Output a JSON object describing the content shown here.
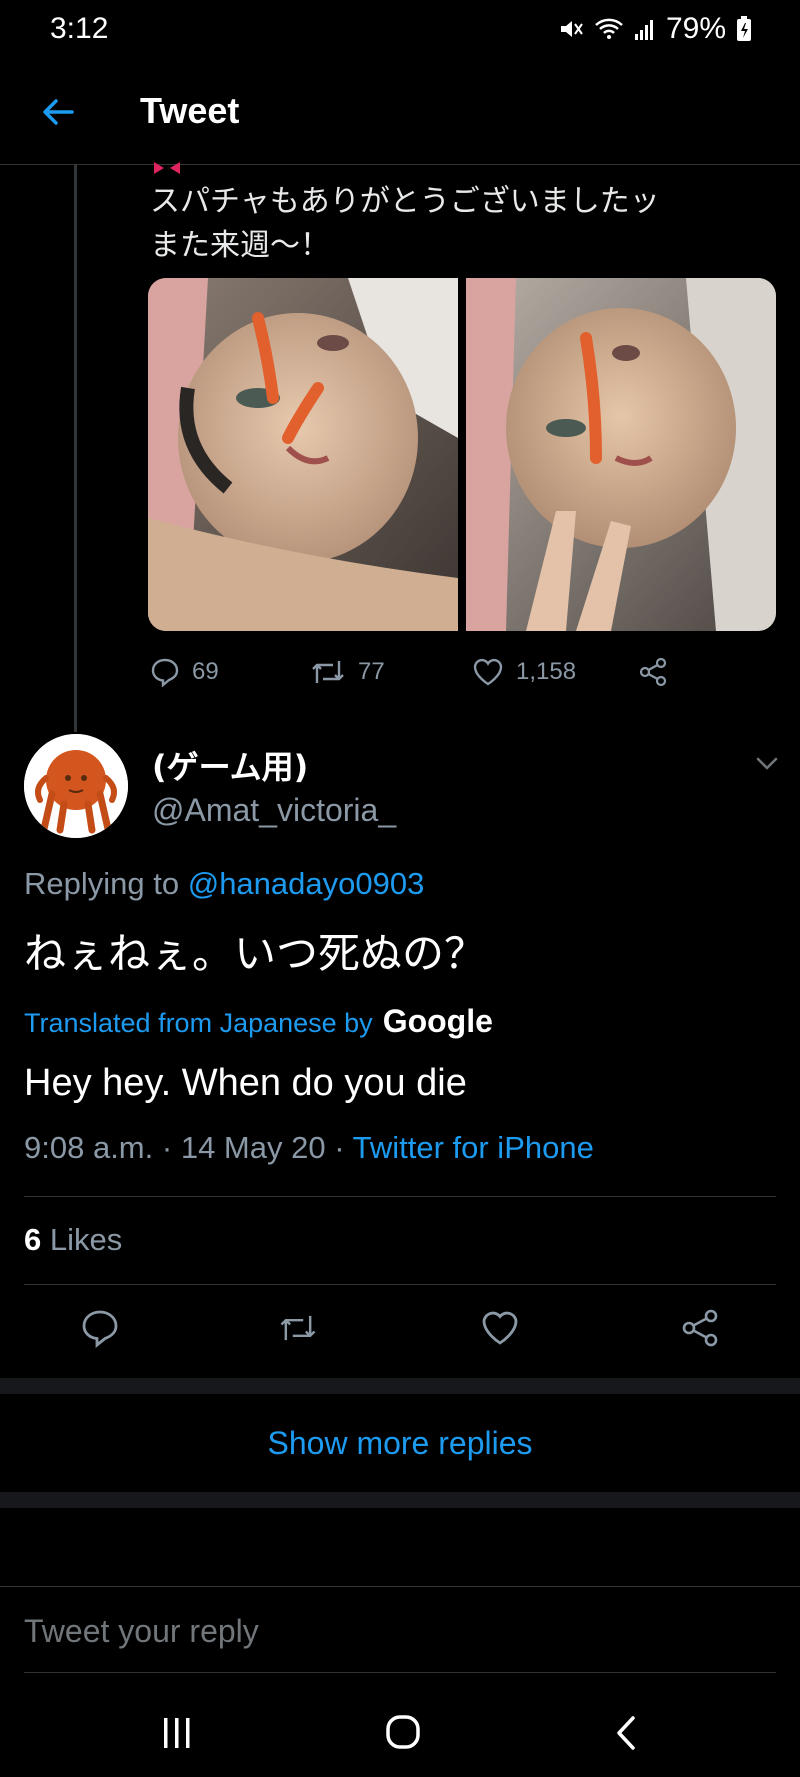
{
  "status_bar": {
    "time": "3:12",
    "battery": "79%"
  },
  "header": {
    "title": "Tweet"
  },
  "parent_tweet": {
    "text_line1": "スパチャもありがとうございましたッ",
    "text_line2": "また来週〜！",
    "replies": "69",
    "retweets": "77",
    "likes": "1,158"
  },
  "reply": {
    "name": "(ゲーム用)",
    "handle": "@Amat_victoria_",
    "replying_prefix": "Replying to",
    "replying_to": "@hanadayo0903",
    "text": "ねぇねぇ。いつ死ぬの？",
    "translated_label": "Translated from Japanese by",
    "translator": "Google",
    "translation": "Hey hey. When do you die",
    "time": "9:08 a.m.",
    "date": "14 May 20",
    "client": "Twitter for iPhone",
    "likes_count": "6",
    "likes_label": "Likes"
  },
  "show_more": "Show more replies",
  "composer": {
    "placeholder": "Tweet your reply"
  },
  "colors": {
    "accent": "#1d9bf0",
    "muted": "#8b98a5",
    "bg": "#000000"
  }
}
